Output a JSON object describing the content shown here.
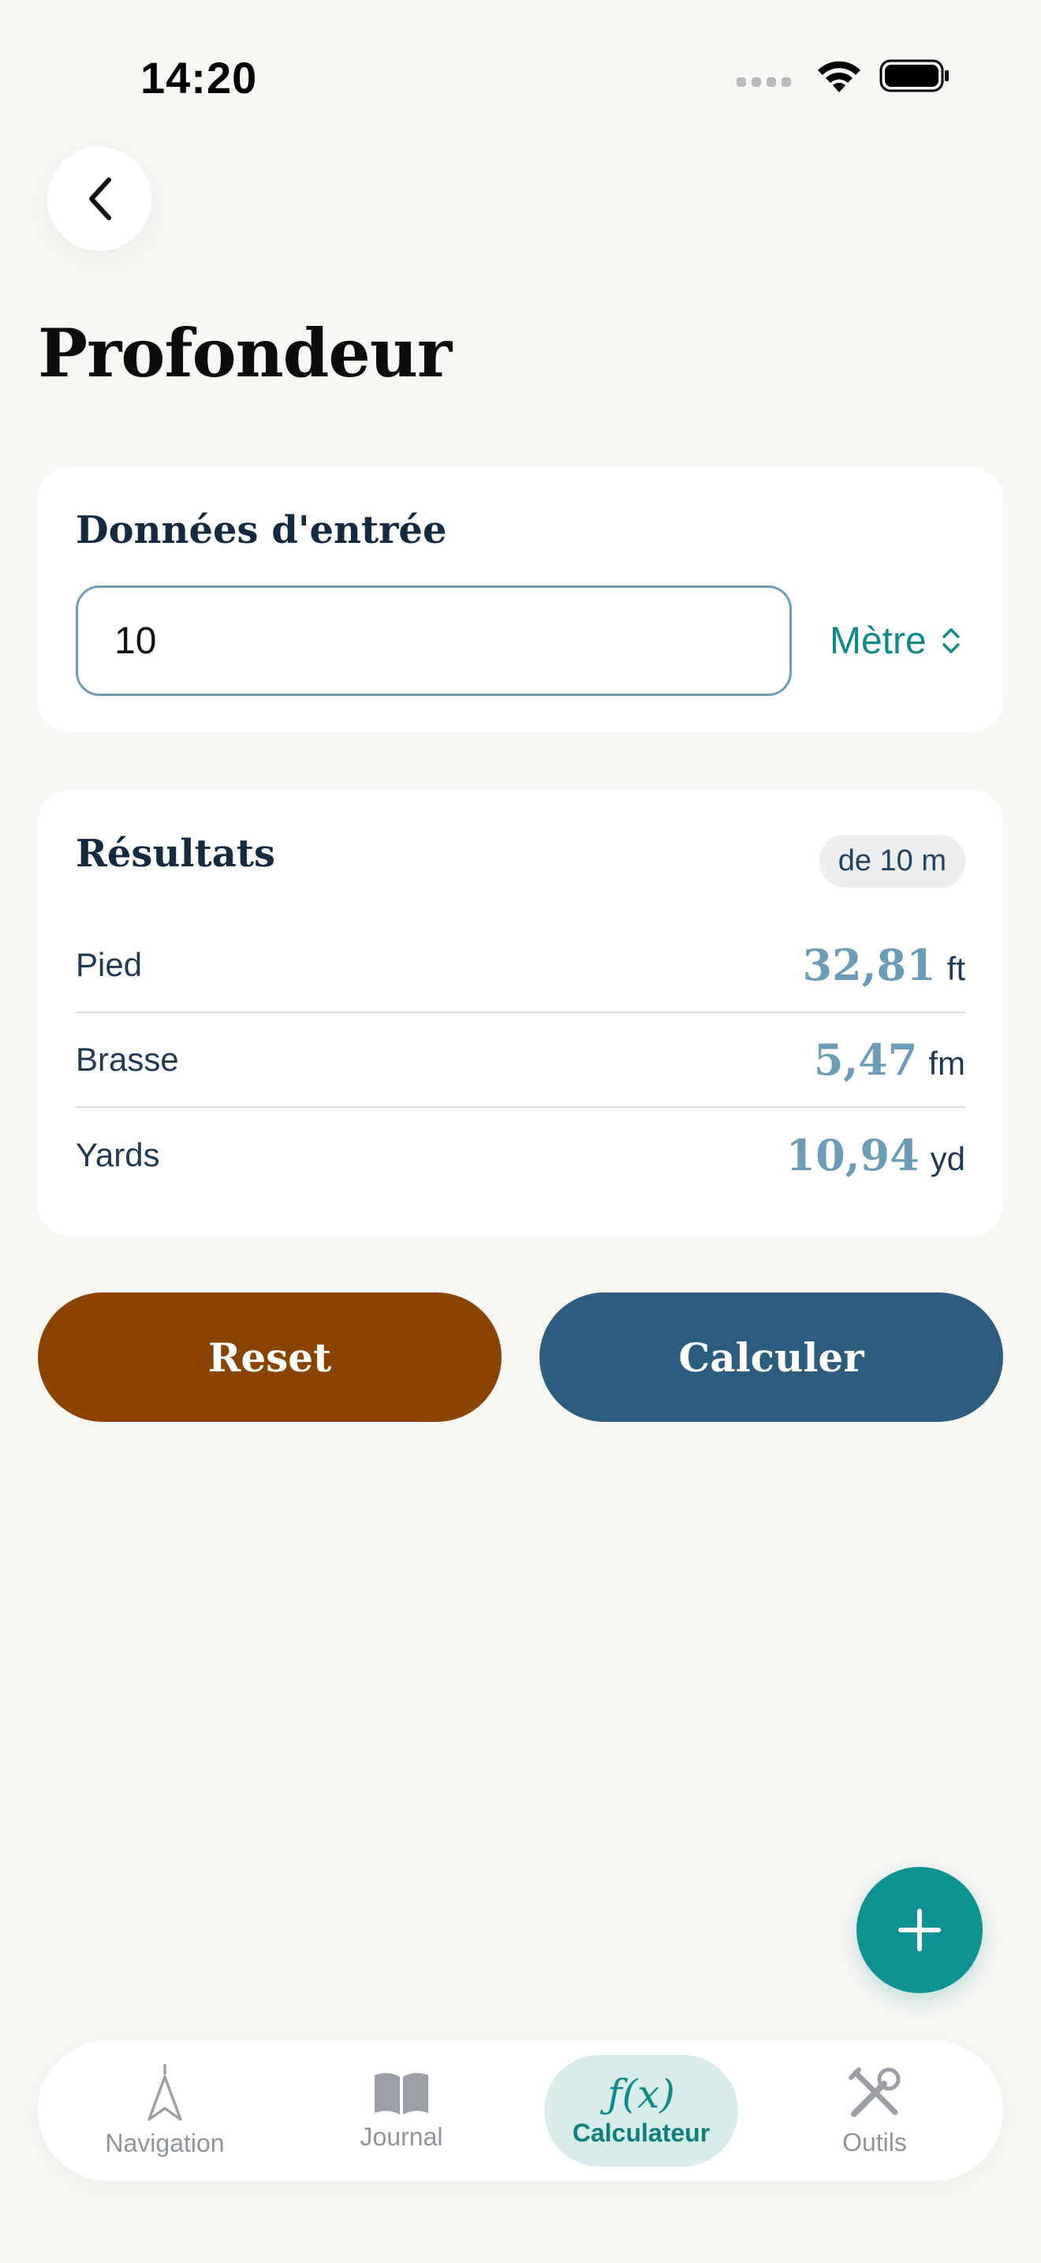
{
  "status_bar": {
    "time": "14:20"
  },
  "header": {
    "title": "Profondeur"
  },
  "input_card": {
    "title": "Données d'entrée",
    "value": "10",
    "unit": "Mètre"
  },
  "results_card": {
    "title": "Résultats",
    "badge": "de 10 m",
    "rows": [
      {
        "label": "Pied",
        "value": "32,81",
        "unit": "ft"
      },
      {
        "label": "Brasse",
        "value": "5,47",
        "unit": "fm"
      },
      {
        "label": "Yards",
        "value": "10,94",
        "unit": "yd"
      }
    ]
  },
  "actions": {
    "reset_label": "Reset",
    "calculate_label": "Calculer"
  },
  "tabbar": {
    "items": [
      {
        "label": "Navigation",
        "icon": "navigation-arrow-icon"
      },
      {
        "label": "Journal",
        "icon": "book-icon"
      },
      {
        "label": "Calculateur",
        "icon": "function-icon",
        "icon_text": "ƒ(x)",
        "active": true
      },
      {
        "label": "Outils",
        "icon": "tools-icon"
      }
    ]
  },
  "colors": {
    "background": "#f9f7f4",
    "accent_teal": "#0e9191",
    "reset_brown": "#8a4400",
    "calculate_blue": "#2d5d7e",
    "result_value": "#6b9db8"
  }
}
